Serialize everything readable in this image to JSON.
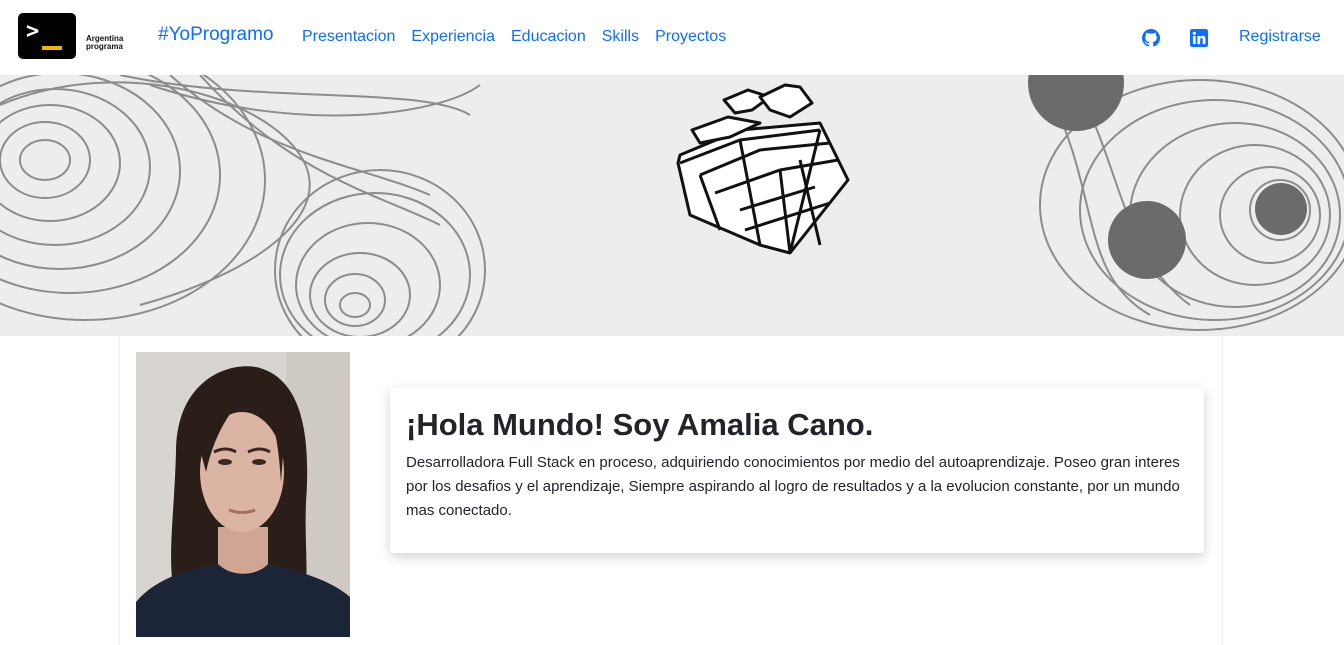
{
  "navbar": {
    "logo_text_line1": "Argentina",
    "logo_text_line2": "programa",
    "brand": "#YoProgramo",
    "links": [
      "Presentacion",
      "Experiencia",
      "Educacion",
      "Skills",
      "Proyectos"
    ],
    "github_icon": "github-icon",
    "linkedin_icon": "linkedin-icon",
    "register_label": "Registrarse"
  },
  "about": {
    "heading": "¡Hola Mundo! Soy Amalia Cano.",
    "description": "Desarrolladora Full Stack en proceso, adquiriendo conocimientos por medio del autoaprendizaje. Poseo gran interes por los desafios y el aprendizaje, Siempre aspirando al logro de resultados y a la evolucion constante, por un mundo mas conectado."
  },
  "colors": {
    "link": "#0d6efd",
    "banner_bg": "#ededed",
    "linkedin": "#0a66c2"
  }
}
